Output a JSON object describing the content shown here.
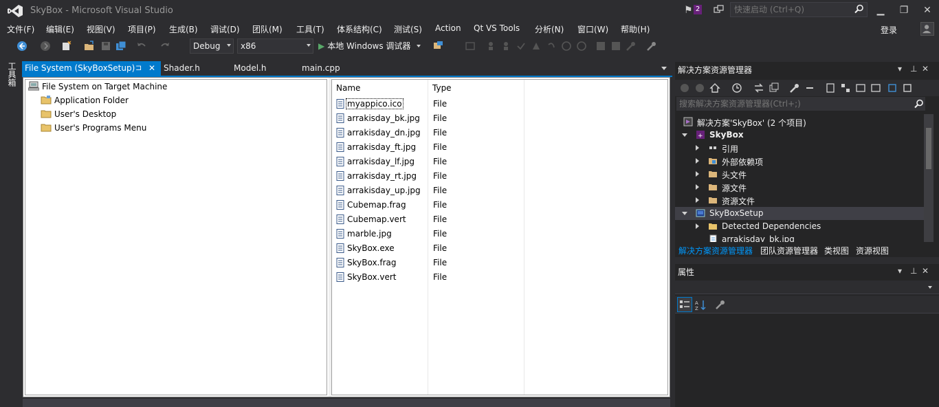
{
  "window": {
    "title": "SkyBox - Microsoft Visual Studio",
    "notification_count": "2",
    "quick_launch_placeholder": "快速启动 (Ctrl+Q)",
    "minimize": "▁",
    "restore": "❐",
    "close": "✕"
  },
  "menu": [
    "文件(F)",
    "编辑(E)",
    "视图(V)",
    "项目(P)",
    "生成(B)",
    "调试(D)",
    "团队(M)",
    "工具(T)",
    "体系结构(C)",
    "测试(S)",
    "Action",
    "Qt VS Tools",
    "分析(N)",
    "窗口(W)",
    "帮助(H)"
  ],
  "account": {
    "login": "登录"
  },
  "toolbar": {
    "config": "Debug",
    "platform": "x86",
    "run_label": "本地 Windows 调试器",
    "play_glyph": "▶"
  },
  "toolbox": {
    "label": "工具箱"
  },
  "doc_tabs": [
    {
      "label": "File System (SkyBoxSetup)",
      "active": true
    },
    {
      "label": "Shader.h"
    },
    {
      "label": "Model.h"
    },
    {
      "label": "main.cpp"
    }
  ],
  "doc_tab_pin": "⊐",
  "doc_tab_close": "✕",
  "file_system": {
    "root": "File System on Target Machine",
    "folders": [
      "Application Folder",
      "User's Desktop",
      "User's Programs Menu"
    ],
    "columns": [
      "Name",
      "Type"
    ],
    "files": [
      {
        "name": "myappico.ico",
        "type": "File"
      },
      {
        "name": "arrakisday_bk.jpg",
        "type": "File"
      },
      {
        "name": "arrakisday_dn.jpg",
        "type": "File"
      },
      {
        "name": "arrakisday_ft.jpg",
        "type": "File"
      },
      {
        "name": "arrakisday_lf.jpg",
        "type": "File"
      },
      {
        "name": "arrakisday_rt.jpg",
        "type": "File"
      },
      {
        "name": "arrakisday_up.jpg",
        "type": "File"
      },
      {
        "name": "Cubemap.frag",
        "type": "File"
      },
      {
        "name": "Cubemap.vert",
        "type": "File"
      },
      {
        "name": "marble.jpg",
        "type": "File"
      },
      {
        "name": "SkyBox.exe",
        "type": "File"
      },
      {
        "name": "SkyBox.frag",
        "type": "File"
      },
      {
        "name": "SkyBox.vert",
        "type": "File"
      }
    ]
  },
  "solution_explorer": {
    "title": "解决方案资源管理器",
    "search_placeholder": "搜索解决方案资源管理器(Ctrl+;)",
    "items": [
      {
        "label": "解决方案'SkyBox' (2 个项目)"
      },
      {
        "label": "SkyBox"
      },
      {
        "label": "引用"
      },
      {
        "label": "外部依赖项"
      },
      {
        "label": "头文件"
      },
      {
        "label": "源文件"
      },
      {
        "label": "资源文件"
      },
      {
        "label": "SkyBoxSetup"
      },
      {
        "label": "Detected Dependencies"
      },
      {
        "label": "arrakisday_bk.jpg"
      }
    ],
    "tabs": [
      "解决方案资源管理器",
      "团队资源管理器",
      "类视图",
      "资源视图"
    ]
  },
  "properties": {
    "title": "属性"
  },
  "panel_controls": {
    "dropdown": "▾",
    "pin": "⊥",
    "close": "✕"
  },
  "colors": {
    "accent": "#007acc",
    "background": "#2d2d30",
    "vs_purple": "#68217a"
  }
}
